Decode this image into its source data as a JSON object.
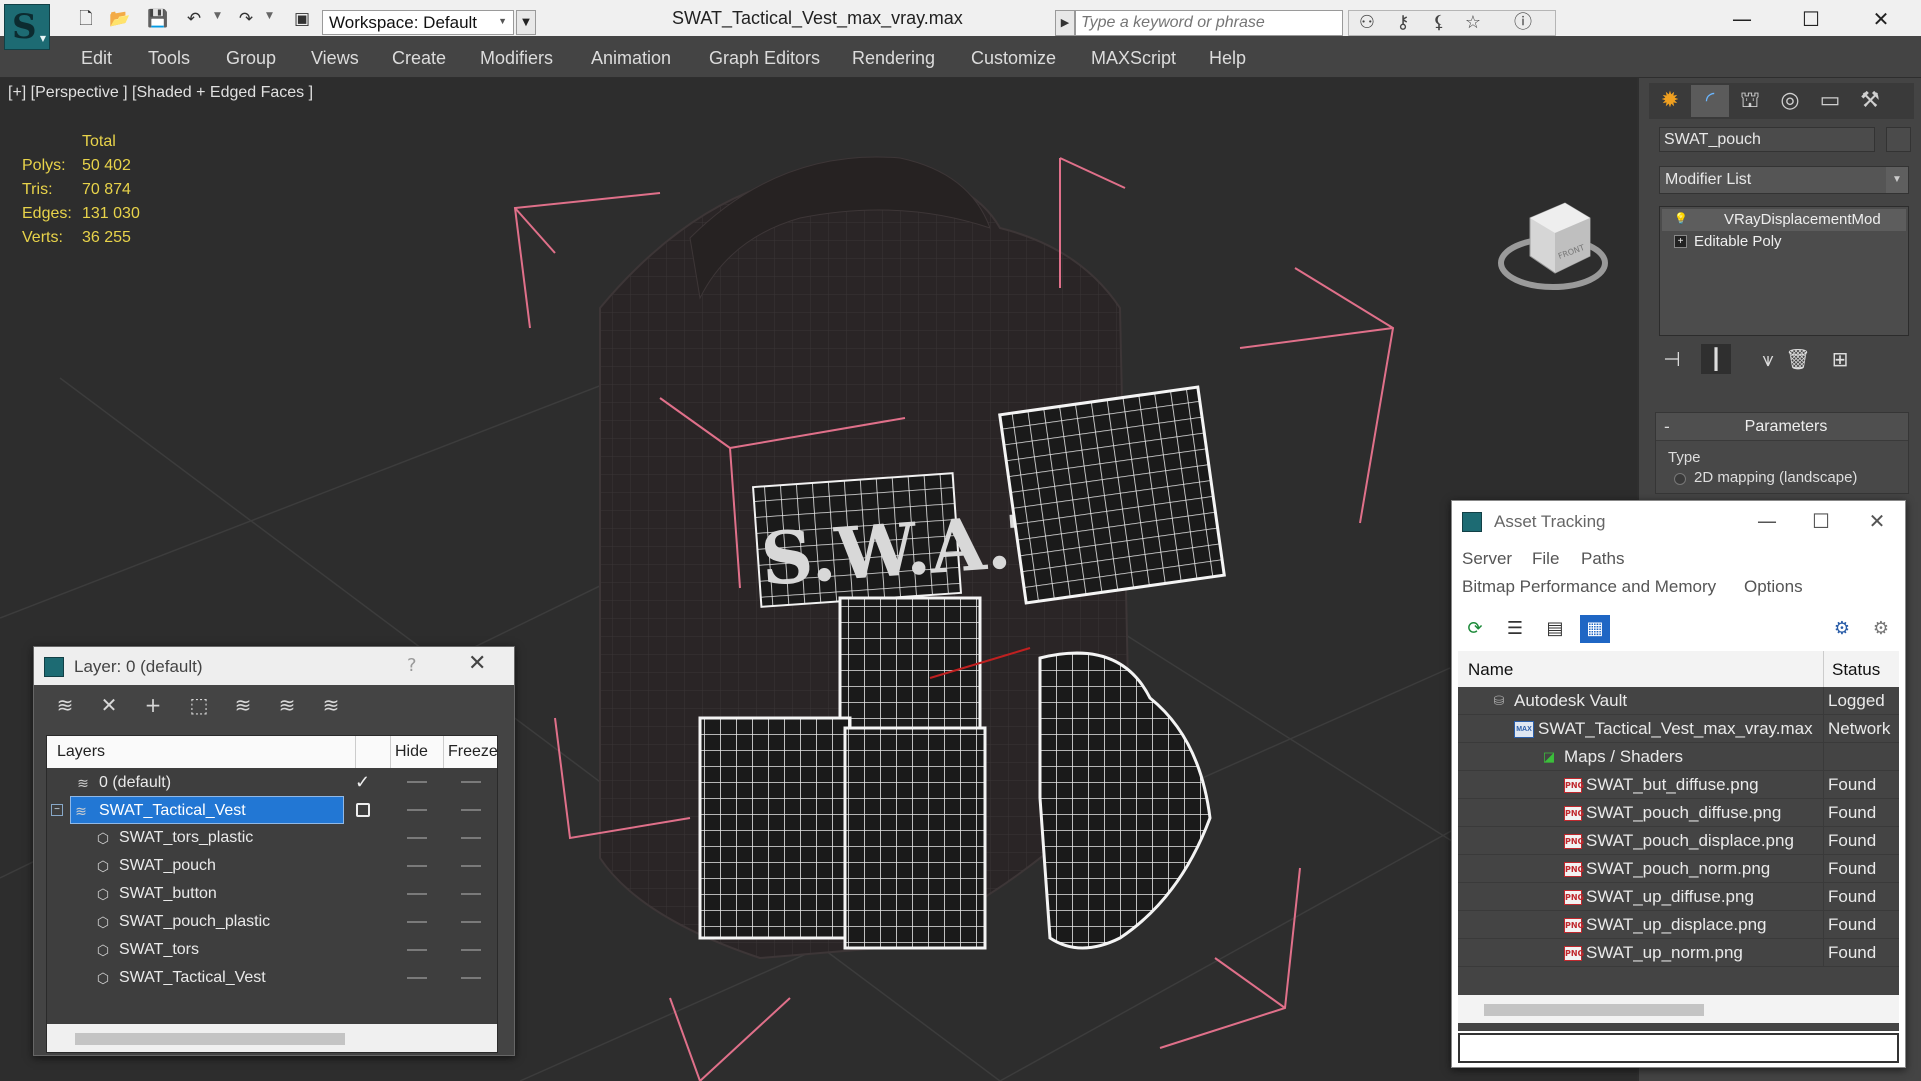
{
  "titlebar": {
    "doc_title": "SWAT_Tactical_Vest_max_vray.max",
    "workspace_label": "Workspace: Default",
    "search_placeholder": "Type a keyword or phrase",
    "quick_access_icons": [
      "new-file-icon",
      "open-file-icon",
      "save-icon",
      "undo-icon",
      "redo-icon",
      "project-icon"
    ],
    "search_tool_icons": [
      "binoculars-icon",
      "key-icon",
      "satellite-icon",
      "star-icon",
      "help-icon"
    ],
    "window_controls": [
      "minimize-icon",
      "maximize-icon",
      "close-icon"
    ]
  },
  "menubar": {
    "items": [
      "Edit",
      "Tools",
      "Group",
      "Views",
      "Create",
      "Modifiers",
      "Animation",
      "Graph Editors",
      "Rendering",
      "Customize",
      "MAXScript",
      "Help"
    ]
  },
  "viewport": {
    "label": "[+] [Perspective ] [Shaded + Edged Faces ]",
    "stats": {
      "header": "Total",
      "rows": [
        {
          "key": "Polys:",
          "value": "50 402"
        },
        {
          "key": "Tris:",
          "value": "70 874"
        },
        {
          "key": "Edges:",
          "value": "131 030"
        },
        {
          "key": "Verts:",
          "value": "36 255"
        }
      ]
    },
    "viewcube_label": "FRONT",
    "patch_text": "S.W.A.T"
  },
  "command_panel": {
    "tabs": [
      "create-icon",
      "modify-icon",
      "hierarchy-icon",
      "motion-icon",
      "display-icon",
      "utilities-icon"
    ],
    "object_name": "SWAT_pouch",
    "modifier_list_label": "Modifier List",
    "stack": [
      {
        "label": "VRayDisplacementMod",
        "icon": "lightbulb-icon"
      },
      {
        "label": "Editable Poly",
        "icon": "expand-plus-icon"
      }
    ],
    "stack_tools": [
      "pin-stack-icon",
      "show-end-result-icon",
      "make-unique-icon",
      "remove-modifier-icon",
      "configure-sets-icon"
    ],
    "rollout_title": "Parameters",
    "rollout_minus": "-",
    "param_type_label": "Type",
    "param_option": "2D mapping (landscape)"
  },
  "layer_window": {
    "title": "Layer: 0 (default)",
    "help": "?",
    "toolbar_icons": [
      "new-layer-icon",
      "delete-layer-icon",
      "add-to-layer-icon",
      "select-objects-icon",
      "highlight-layer-icon",
      "hide-all-layers-icon",
      "freeze-all-layers-icon"
    ],
    "columns": {
      "layers": "Layers",
      "hide": "Hide",
      "freeze": "Freeze"
    },
    "rows": [
      {
        "name": "0 (default)",
        "level": 0,
        "type": "layer",
        "current": true,
        "selected": false
      },
      {
        "name": "SWAT_Tactical_Vest",
        "level": 0,
        "type": "layer",
        "current": false,
        "selected": true,
        "expanded": true
      },
      {
        "name": "SWAT_tors_plastic",
        "level": 1,
        "type": "object"
      },
      {
        "name": "SWAT_pouch",
        "level": 1,
        "type": "object"
      },
      {
        "name": "SWAT_button",
        "level": 1,
        "type": "object"
      },
      {
        "name": "SWAT_pouch_plastic",
        "level": 1,
        "type": "object"
      },
      {
        "name": "SWAT_tors",
        "level": 1,
        "type": "object"
      },
      {
        "name": "SWAT_Tactical_Vest",
        "level": 1,
        "type": "object"
      }
    ]
  },
  "asset_window": {
    "title": "Asset Tracking",
    "menu_row1": [
      "Server",
      "File",
      "Paths"
    ],
    "menu_row2": [
      "Bitmap Performance and Memory",
      "Options"
    ],
    "toolbar_icons": [
      "refresh-icon",
      "list-view-icon",
      "tree-view-icon",
      "table-view-icon"
    ],
    "right_icons": [
      "vault-help-icon",
      "vault-settings-icon"
    ],
    "columns": {
      "name": "Name",
      "status": "Status"
    },
    "rows": [
      {
        "name": "Autodesk Vault",
        "status": "Logged",
        "level": 1,
        "icon": "vault-icon"
      },
      {
        "name": "SWAT_Tactical_Vest_max_vray.max",
        "status": "Network",
        "level": 2,
        "icon": "max-file-icon"
      },
      {
        "name": "Maps / Shaders",
        "status": "",
        "level": 3,
        "icon": "maps-folder-icon"
      },
      {
        "name": "SWAT_but_diffuse.png",
        "status": "Found",
        "level": 4,
        "icon": "png-file-icon"
      },
      {
        "name": "SWAT_pouch_diffuse.png",
        "status": "Found",
        "level": 4,
        "icon": "png-file-icon"
      },
      {
        "name": "SWAT_pouch_displace.png",
        "status": "Found",
        "level": 4,
        "icon": "png-file-icon"
      },
      {
        "name": "SWAT_pouch_norm.png",
        "status": "Found",
        "level": 4,
        "icon": "png-file-icon"
      },
      {
        "name": "SWAT_up_diffuse.png",
        "status": "Found",
        "level": 4,
        "icon": "png-file-icon"
      },
      {
        "name": "SWAT_up_displace.png",
        "status": "Found",
        "level": 4,
        "icon": "png-file-icon"
      },
      {
        "name": "SWAT_up_norm.png",
        "status": "Found",
        "level": 4,
        "icon": "png-file-icon"
      }
    ]
  },
  "colors": {
    "stats_yellow": "#e8d34a",
    "selection_blue": "#2277d4",
    "bbox_pink": "#e0708a",
    "viewport_bg": "#2d2d2d"
  }
}
